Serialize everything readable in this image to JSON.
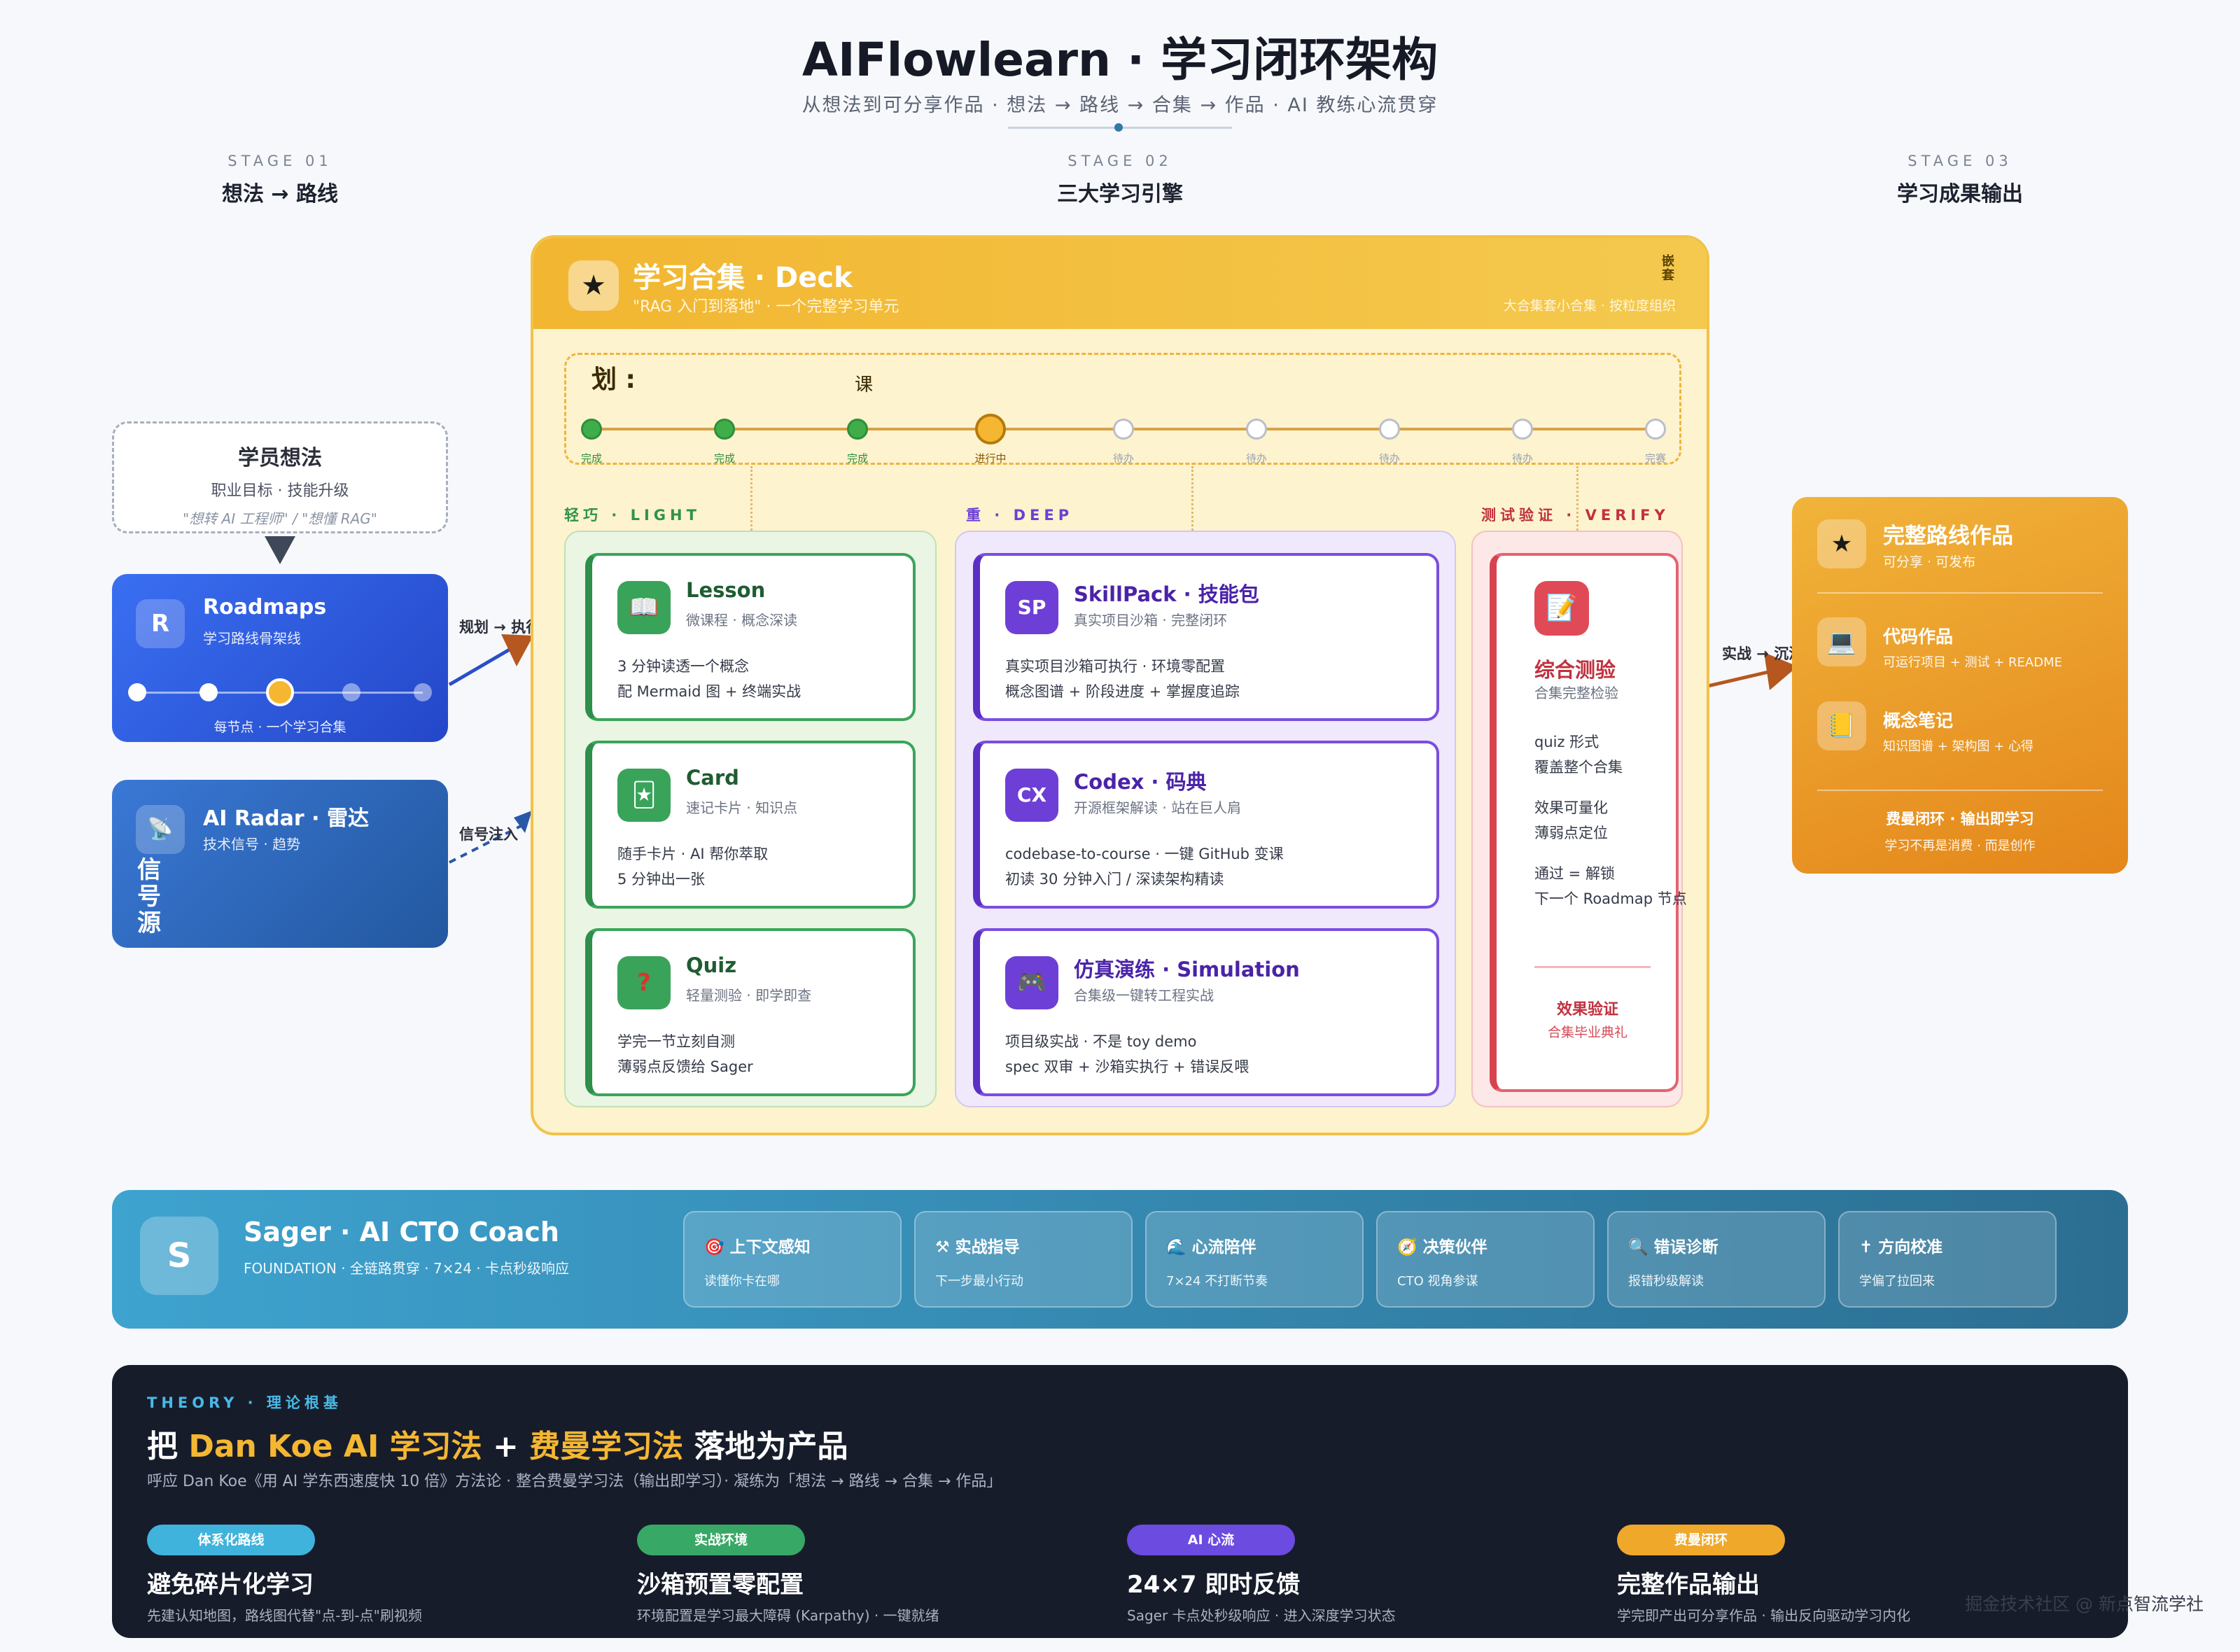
{
  "header": {
    "title": "AIFlowlearn · 学习闭环架构",
    "subtitle": "从想法到可分享作品 · 想法 → 路线 → 合集 → 作品 · AI 教练心流贯穿"
  },
  "stages": [
    {
      "key": "STAGE 01",
      "title": "想法 → 路线"
    },
    {
      "key": "STAGE 02",
      "title": "三大学习引擎"
    },
    {
      "key": "STAGE 03",
      "title": "学习成果输出"
    }
  ],
  "idea": {
    "title": "学员想法",
    "subtitle": "职业目标 · 技能升级",
    "quote": "\"想转 AI 工程师\" / \"想懂 RAG\""
  },
  "roadmaps": {
    "badge": "R",
    "title": "Roadmaps",
    "subtitle": "学习路线骨架线",
    "caption": "每节点 · 一个学习合集",
    "nodes": 5,
    "current": 2
  },
  "radar": {
    "title": "AI Radar · 雷达",
    "subtitle": "技术信号 · 趋势",
    "side": "信号源"
  },
  "arrows": {
    "plan": "规划 → 执行",
    "signal": "信号注入",
    "practice": "实战 → 沉淀"
  },
  "deck": {
    "title": "学习合集 · Deck",
    "subtitle": "\"RAG 入门到落地\" · 一个完整学习单元",
    "mini": "嵌套",
    "right": "大合集套小合集 · 按粒度组织",
    "progress_tag1": "划 :",
    "progress_tag2": "课",
    "progress": [
      "完成",
      "完成",
      "完成",
      "进行中",
      "待办",
      "待办",
      "待办",
      "待办",
      "完赛"
    ]
  },
  "categories": {
    "light": "轻巧 · LIGHT",
    "deep": "重 · DEEP",
    "verify": "测试验证 · VERIFY"
  },
  "light_cards": [
    {
      "icon": "📖",
      "title": "Lesson",
      "sub": "微课程 · 概念深读",
      "l1": "3 分钟读透一个概念",
      "l2": "配 Mermaid 图 + 终端实战"
    },
    {
      "icon": "🃏",
      "title": "Card",
      "sub": "速记卡片 · 知识点",
      "l1": "随手卡片 · AI 帮你萃取",
      "l2": "5 分钟出一张"
    },
    {
      "icon": "?",
      "title": "Quiz",
      "sub": "轻量测验 · 即学即查",
      "l1": "学完一节立刻自测",
      "l2": "薄弱点反馈给 Sager"
    }
  ],
  "deep_cards": [
    {
      "icon": "SP",
      "title": "SkillPack · 技能包",
      "sub": "真实项目沙箱 · 完整闭环",
      "l1": "真实项目沙箱可执行 · 环境零配置",
      "l2": "概念图谱 + 阶段进度 + 掌握度追踪"
    },
    {
      "icon": "CX",
      "title": "Codex · 码典",
      "sub": "开源框架解读 · 站在巨人肩",
      "l1": "codebase-to-course · 一键 GitHub 变课",
      "l2": "初读 30 分钟入门 / 深读架构精读"
    },
    {
      "icon": "🎮",
      "title": "仿真演练 · Simulation",
      "sub": "合集级一键转工程实战",
      "l1": "项目级实战 · 不是 toy demo",
      "l2": "spec 双审 + 沙箱实执行 + 错误反喂"
    }
  ],
  "verify": {
    "icon": "📝",
    "title": "综合测验",
    "sub": "合集完整检验",
    "lines": [
      "quiz 形式",
      "覆盖整个合集",
      "效果可量化",
      "薄弱点定位",
      "通过 = 解锁",
      "下一个 Roadmap 节点"
    ],
    "badge": "效果验证",
    "badge_sub": "合集毕业典礼"
  },
  "output": {
    "title": "完整路线作品",
    "subtitle": "可分享 · 可发布",
    "items": [
      {
        "icon": "💻",
        "title": "代码作品",
        "sub": "可运行项目 + 测试 + README"
      },
      {
        "icon": "📒",
        "title": "概念笔记",
        "sub": "知识图谱 + 架构图 + 心得"
      }
    ],
    "footer_title": "费曼闭环 · 输出即学习",
    "footer_sub": "学习不再是消费 · 而是创作"
  },
  "sager": {
    "badge": "S",
    "title": "Sager · AI CTO Coach",
    "subtitle": "FOUNDATION · 全链路贯穿 · 7×24 · 卡点秒级响应",
    "features": [
      {
        "icon": "🎯",
        "title": "上下文感知",
        "sub": "读懂你卡在哪"
      },
      {
        "icon": "⚒",
        "title": "实战指导",
        "sub": "下一步最小行动"
      },
      {
        "icon": "🌊",
        "title": "心流陪伴",
        "sub": "7×24 不打断节奏"
      },
      {
        "icon": "🧭",
        "title": "决策伙伴",
        "sub": "CTO 视角参谋"
      },
      {
        "icon": "🔍",
        "title": "错误诊断",
        "sub": "报错秒级解读"
      },
      {
        "icon": "✝",
        "title": "方向校准",
        "sub": "学偏了拉回来"
      }
    ]
  },
  "theory": {
    "kicker": "THEORY · 理论根基",
    "title_a": "把 ",
    "title_b": "Dan Koe AI 学习法",
    "title_c": " + ",
    "title_d": "费曼学习法",
    "title_e": " 落地为产品",
    "subtitle": "呼应 Dan Koe《用 AI 学东西速度快 10 倍》方法论 · 整合费曼学习法（输出即学习）· 凝练为「想法 → 路线 → 合集 → 作品」",
    "pillars": [
      {
        "pill": "体系化路线",
        "color": "#3fb3dc",
        "title": "避免碎片化学习",
        "sub": "先建认知地图，路线图代替\"点-到-点\"刷视频"
      },
      {
        "pill": "实战环境",
        "color": "#38a866",
        "title": "沙箱预置零配置",
        "sub": "环境配置是学习最大障碍 (Karpathy) · 一键就绪"
      },
      {
        "pill": "AI 心流",
        "color": "#6c4be0",
        "title": "24×7 即时反馈",
        "sub": "Sager 卡点处秒级响应 · 进入深度学习状态"
      },
      {
        "pill": "费曼闭环",
        "color": "#f0a82a",
        "title": "完整作品输出",
        "sub": "学完即产出可分享作品 · 输出反向驱动学习内化"
      }
    ]
  },
  "watermark": "掘金技术社区 @ 新点智流学社",
  "colors": {
    "light": "#39a35a",
    "deep": "#6d3fd6",
    "verify": "#d8424f",
    "gold": "#f2b631"
  }
}
